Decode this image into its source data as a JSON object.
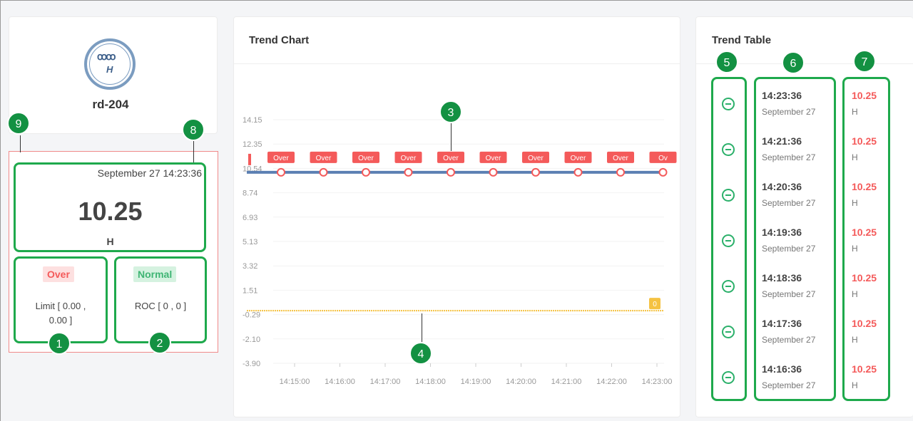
{
  "device": {
    "name": "rd-204",
    "icon": "inductor-icon"
  },
  "current": {
    "datetime": "September 27 14:23:36",
    "value": "10.25",
    "unit": "H"
  },
  "limit": {
    "status": "Over",
    "text": "Limit [ 0.00 ,",
    "text2": "0.00 ]"
  },
  "roc": {
    "status": "Normal",
    "text": "ROC [ 0 , 0 ]"
  },
  "callouts": [
    "1",
    "2",
    "3",
    "4",
    "5",
    "6",
    "7",
    "8",
    "9"
  ],
  "chart": {
    "title": "Trend Chart",
    "roc_label": "0"
  },
  "chart_data": {
    "type": "line",
    "title": "Trend Chart",
    "y_ticks": [
      "14.15",
      "12.35",
      "10.54",
      "8.74",
      "6.93",
      "5.13",
      "3.32",
      "1.51",
      "-0.29",
      "-2.10",
      "-3.90"
    ],
    "ylim": [
      -3.9,
      14.15
    ],
    "x_ticks": [
      "14:15:00",
      "14:16:00",
      "14:17:00",
      "14:18:00",
      "14:19:00",
      "14:20:00",
      "14:21:00",
      "14:22:00",
      "14:23:00"
    ],
    "series": [
      {
        "values": [
          10.25,
          10.25,
          10.25,
          10.25,
          10.25,
          10.25,
          10.25,
          10.25,
          10.25,
          10.25
        ],
        "point_labels": [
          "Over",
          "Over",
          "Over",
          "Over",
          "Over",
          "Over",
          "Over",
          "Over",
          "Over",
          "Ov"
        ]
      },
      {
        "values": [
          0,
          0,
          0,
          0,
          0,
          0,
          0,
          0,
          0,
          0
        ]
      }
    ],
    "grid": true
  },
  "table": {
    "title": "Trend Table",
    "rows": [
      {
        "time": "14:23:36",
        "date": "September 27",
        "value": "10.25",
        "unit": "H"
      },
      {
        "time": "14:21:36",
        "date": "September 27",
        "value": "10.25",
        "unit": "H"
      },
      {
        "time": "14:20:36",
        "date": "September 27",
        "value": "10.25",
        "unit": "H"
      },
      {
        "time": "14:19:36",
        "date": "September 27",
        "value": "10.25",
        "unit": "H"
      },
      {
        "time": "14:18:36",
        "date": "September 27",
        "value": "10.25",
        "unit": "H"
      },
      {
        "time": "14:17:36",
        "date": "September 27",
        "value": "10.25",
        "unit": "H"
      },
      {
        "time": "14:16:36",
        "date": "September 27",
        "value": "10.25",
        "unit": "H"
      }
    ]
  },
  "colors": {
    "accent_green": "#139142",
    "over_red": "#f45a5a",
    "line_blue": "#5b7fb3",
    "roc_yellow": "#f5c242"
  }
}
